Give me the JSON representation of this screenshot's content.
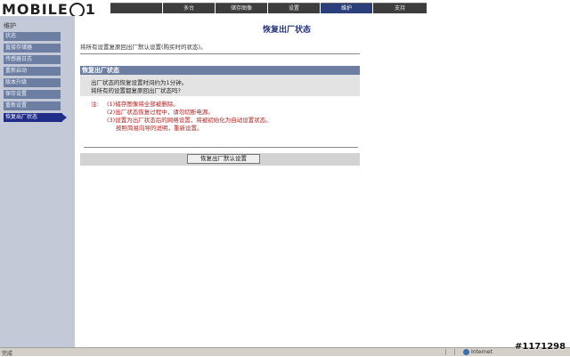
{
  "brand": {
    "logo_text_a": "MOBILE",
    "logo_text_b": "1"
  },
  "tabs": [
    {
      "label": ""
    },
    {
      "label": "多台"
    },
    {
      "label": "储存图像"
    },
    {
      "label": "设置"
    },
    {
      "label": "维护",
      "active": true
    },
    {
      "label": "支持"
    }
  ],
  "sidebar": {
    "title": "维护",
    "items": [
      {
        "label": "状态"
      },
      {
        "label": "直接存储器"
      },
      {
        "label": "传感器日志"
      },
      {
        "label": "重新启动"
      },
      {
        "label": "版本升级"
      },
      {
        "label": "保存设置"
      },
      {
        "label": "重新设置"
      },
      {
        "label": "恢复出厂状态",
        "active": true
      }
    ]
  },
  "main": {
    "title": "恢复出厂状态",
    "intro": "将所有设置复原回出厂默认设置(购买时的状态)。",
    "section_title": "恢复出厂状态",
    "question_line1": "出厂状态的恢复设置时间约为1分钟。",
    "question_line2": "将所有的设置都复原回出厂状态吗?",
    "note_label": "注:",
    "notes": [
      "(1)储存图像将全部被删除。",
      "(2)出厂状态恢复过程中，请勿切断电源。",
      "(3)设置为出厂状态后的网络设置，将被初始化为自动设置状态。",
      "按照简易向导的说明，重新设置。"
    ],
    "button_label": "恢复出厂默认设置"
  },
  "statusbar": {
    "left_text": "完成",
    "zone_text": "Internet"
  },
  "watermark": "#1171298",
  "colors": {
    "active_tab": "#2b3f7a",
    "tab": "#3d3d3d",
    "nav_item": "#6d7ea3",
    "nav_active": "#1f2c88",
    "title": "#24337a",
    "note": "#b02020",
    "sidebar_bg": "#c4c9d8"
  }
}
